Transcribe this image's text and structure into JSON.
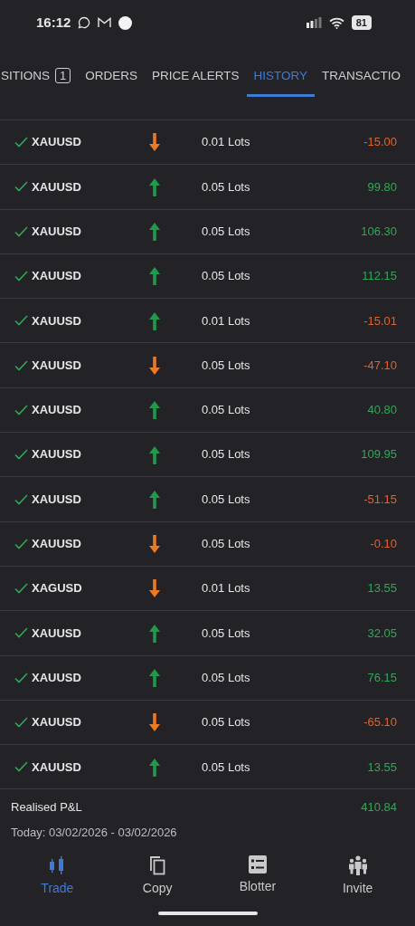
{
  "status_bar": {
    "time": "16:12",
    "battery": "81"
  },
  "tabs": [
    {
      "label": "SITIONS",
      "badge": "1",
      "selected": false
    },
    {
      "label": "ORDERS",
      "selected": false
    },
    {
      "label": "PRICE ALERTS",
      "selected": false
    },
    {
      "label": "HISTORY",
      "selected": true
    },
    {
      "label": "TRANSACTIO",
      "selected": false
    }
  ],
  "rows": [
    {
      "symbol": "XAUUSD",
      "buy": false,
      "size": "0.01 Lots",
      "pnl": "-15.00",
      "profit": false
    },
    {
      "symbol": "XAUUSD",
      "buy": true,
      "size": "0.05 Lots",
      "pnl": "99.80",
      "profit": true
    },
    {
      "symbol": "XAUUSD",
      "buy": true,
      "size": "0.05 Lots",
      "pnl": "106.30",
      "profit": true
    },
    {
      "symbol": "XAUUSD",
      "buy": true,
      "size": "0.05 Lots",
      "pnl": "112.15",
      "profit": true
    },
    {
      "symbol": "XAUUSD",
      "buy": true,
      "size": "0.01 Lots",
      "pnl": "-15.01",
      "profit": false
    },
    {
      "symbol": "XAUUSD",
      "buy": false,
      "size": "0.05 Lots",
      "pnl": "-47.10",
      "profit": false
    },
    {
      "symbol": "XAUUSD",
      "buy": true,
      "size": "0.05 Lots",
      "pnl": "40.80",
      "profit": true
    },
    {
      "symbol": "XAUUSD",
      "buy": true,
      "size": "0.05 Lots",
      "pnl": "109.95",
      "profit": true
    },
    {
      "symbol": "XAUUSD",
      "buy": true,
      "size": "0.05 Lots",
      "pnl": "-51.15",
      "profit": false
    },
    {
      "symbol": "XAUUSD",
      "buy": false,
      "size": "0.05 Lots",
      "pnl": "-0.10",
      "profit": false
    },
    {
      "symbol": "XAGUSD",
      "buy": false,
      "size": "0.01 Lots",
      "pnl": "13.55",
      "profit": true
    },
    {
      "symbol": "XAUUSD",
      "buy": true,
      "size": "0.05 Lots",
      "pnl": "32.05",
      "profit": true
    },
    {
      "symbol": "XAUUSD",
      "buy": true,
      "size": "0.05 Lots",
      "pnl": "76.15",
      "profit": true
    },
    {
      "symbol": "XAUUSD",
      "buy": false,
      "size": "0.05 Lots",
      "pnl": "-65.10",
      "profit": false
    },
    {
      "symbol": "XAUUSD",
      "buy": true,
      "size": "0.05 Lots",
      "pnl": "13.55",
      "profit": true
    }
  ],
  "summary": {
    "label": "Realised P&L",
    "value": "410.84",
    "profit": true,
    "period": "Today: 03/02/2026 - 03/02/2026"
  },
  "nav": [
    {
      "label": "Trade",
      "kind": "trade",
      "selected": true
    },
    {
      "label": "Copy",
      "kind": "copy",
      "selected": false
    },
    {
      "label": "Blotter",
      "kind": "blotter",
      "selected": false
    },
    {
      "label": "Invite",
      "kind": "invite",
      "selected": false
    }
  ]
}
